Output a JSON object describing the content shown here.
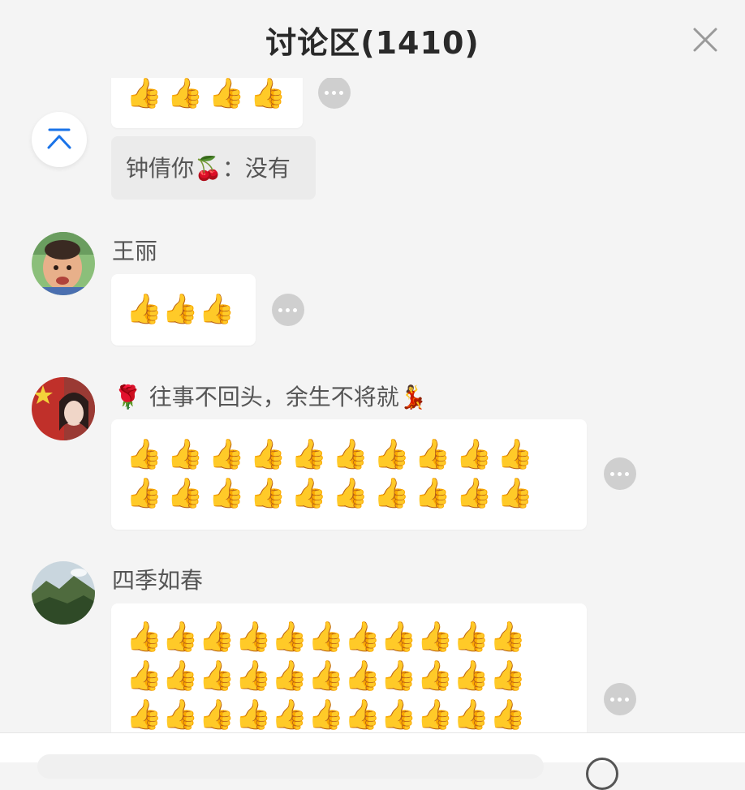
{
  "header": {
    "title": "讨论区(1410)"
  },
  "icons": {
    "close": "close-icon",
    "scroll_top": "scroll-to-top-icon",
    "more": "more-options-icon"
  },
  "comments": [
    {
      "thumbs_rows": [
        "👍👍👍👍"
      ],
      "reply": "钟倩你🍒：没有"
    },
    {
      "username": "王丽",
      "thumbs_rows": [
        "👍👍👍"
      ]
    },
    {
      "username": "🌹 往事不回头，余生不将就💃",
      "thumbs_rows": [
        "👍👍👍👍👍👍👍👍👍👍",
        "👍👍👍👍👍👍👍👍👍👍"
      ]
    },
    {
      "username": "四季如春",
      "thumbs_rows": [
        "👍👍👍👍👍👍👍👍👍👍👍",
        "👍👍👍👍👍👍👍👍👍👍👍",
        "👍👍👍👍👍👍👍👍👍👍👍"
      ]
    }
  ],
  "colors": {
    "background": "#f4f4f4",
    "accent": "#1a73e8"
  }
}
